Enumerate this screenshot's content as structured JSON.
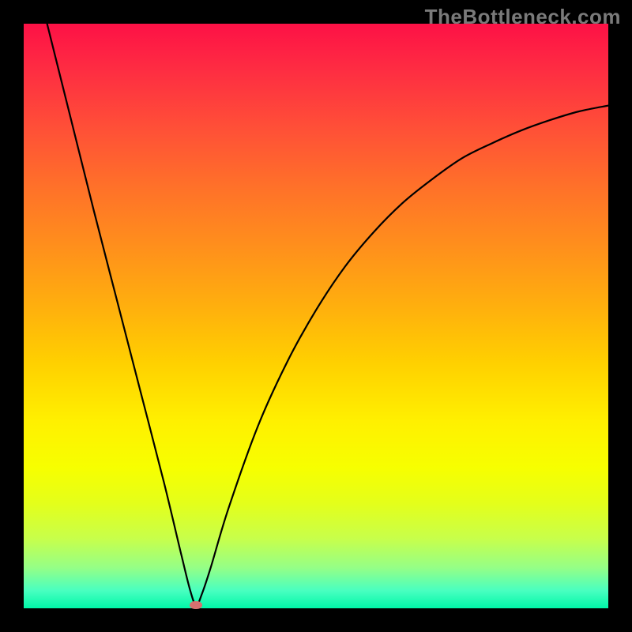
{
  "watermark": "TheBottleneck.com",
  "colors": {
    "frame": "#000000",
    "marker": "#d77070",
    "curve": "#000000",
    "gradient_stops": [
      {
        "pct": 0,
        "color": "#fd1146"
      },
      {
        "pct": 8,
        "color": "#fe2d42"
      },
      {
        "pct": 18,
        "color": "#ff5037"
      },
      {
        "pct": 28,
        "color": "#ff7129"
      },
      {
        "pct": 38,
        "color": "#ff8f1c"
      },
      {
        "pct": 48,
        "color": "#ffae0e"
      },
      {
        "pct": 58,
        "color": "#ffd000"
      },
      {
        "pct": 68,
        "color": "#fff000"
      },
      {
        "pct": 76,
        "color": "#f7ff00"
      },
      {
        "pct": 82,
        "color": "#e4ff1a"
      },
      {
        "pct": 88,
        "color": "#c8ff4a"
      },
      {
        "pct": 93,
        "color": "#96ff86"
      },
      {
        "pct": 97,
        "color": "#48ffc0"
      },
      {
        "pct": 100,
        "color": "#00f7a8"
      }
    ]
  },
  "chart_data": {
    "type": "line",
    "title": "",
    "xlabel": "",
    "ylabel": "",
    "xlim": [
      0,
      100
    ],
    "ylim": [
      0,
      100
    ],
    "marker": {
      "x": 29.5,
      "y": 0.5
    },
    "series": [
      {
        "name": "bottleneck-curve",
        "points": [
          {
            "x": 4.0,
            "y": 100.0
          },
          {
            "x": 8.0,
            "y": 84.0
          },
          {
            "x": 12.0,
            "y": 68.0
          },
          {
            "x": 16.0,
            "y": 52.5
          },
          {
            "x": 20.0,
            "y": 37.0
          },
          {
            "x": 24.0,
            "y": 21.5
          },
          {
            "x": 27.0,
            "y": 9.0
          },
          {
            "x": 28.5,
            "y": 3.0
          },
          {
            "x": 29.5,
            "y": 0.5
          },
          {
            "x": 30.5,
            "y": 2.5
          },
          {
            "x": 32.0,
            "y": 7.0
          },
          {
            "x": 35.0,
            "y": 17.0
          },
          {
            "x": 40.0,
            "y": 31.0
          },
          {
            "x": 45.0,
            "y": 42.0
          },
          {
            "x": 50.0,
            "y": 51.0
          },
          {
            "x": 55.0,
            "y": 58.5
          },
          {
            "x": 60.0,
            "y": 64.5
          },
          {
            "x": 65.0,
            "y": 69.5
          },
          {
            "x": 70.0,
            "y": 73.5
          },
          {
            "x": 75.0,
            "y": 77.0
          },
          {
            "x": 80.0,
            "y": 79.5
          },
          {
            "x": 85.0,
            "y": 81.7
          },
          {
            "x": 90.0,
            "y": 83.5
          },
          {
            "x": 95.0,
            "y": 85.0
          },
          {
            "x": 100.0,
            "y": 86.0
          }
        ]
      }
    ]
  }
}
